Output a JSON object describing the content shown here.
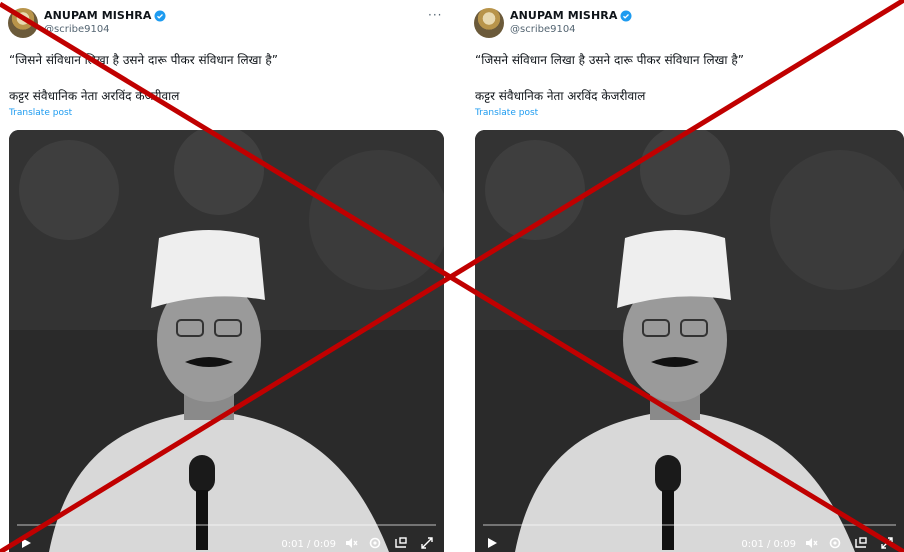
{
  "posts": [
    {
      "author": "ANUPAM MISHRA",
      "handle": "@scribe9104",
      "more": "···",
      "text1": "“जिसने संविधान लिखा है उसने दारू पीकर संविधान लिखा है”",
      "text2": "कट्टर संवैधानिक नेता अरविंद केजरीवाल",
      "translate": "Translate post",
      "video": {
        "time": "0:01 / 0:09"
      }
    },
    {
      "author": "ANUPAM MISHRA",
      "handle": "@scribe9104",
      "text1": "“जिसने संविधान लिखा है उसने दारू पीकर संविधान लिखा है”",
      "text2": "कट्टर संवैधानिक नेता अरविंद केजरीवाल",
      "translate": "Translate post",
      "video": {
        "time": "0:01 / 0:09"
      }
    }
  ],
  "colors": {
    "cross": "#c00000",
    "link": "#1d9bf0",
    "verified": "#1d9bf0"
  }
}
